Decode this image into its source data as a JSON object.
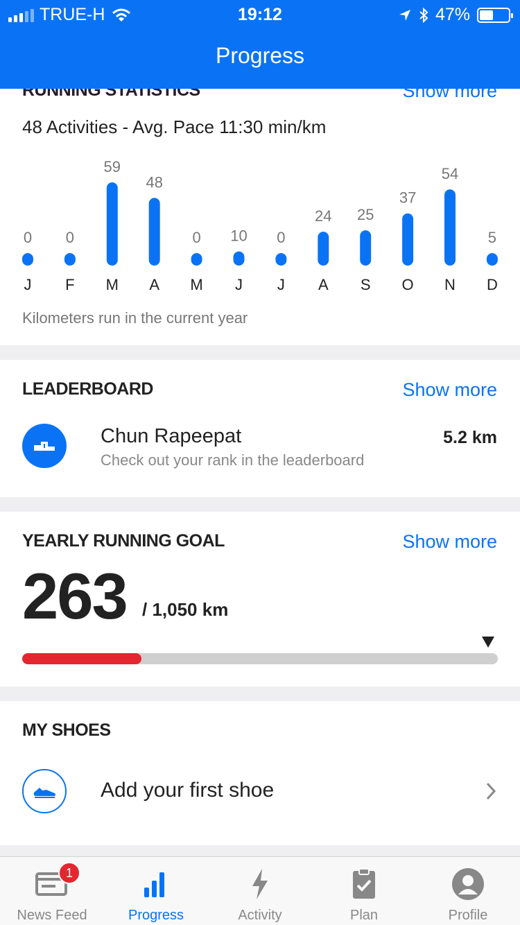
{
  "status_bar": {
    "carrier": "TRUE-H",
    "time": "19:12",
    "battery": "47%",
    "battery_level": 0.47
  },
  "header": {
    "title": "Progress"
  },
  "running_statistics": {
    "title": "RUNNING STATISTICS",
    "show_more": "Show more",
    "summary": "48 Activities - Avg. Pace 11:30 min/km",
    "caption": "Kilometers run in the current year"
  },
  "chart_data": {
    "type": "bar",
    "categories": [
      "J",
      "F",
      "M",
      "A",
      "M",
      "J",
      "J",
      "A",
      "S",
      "O",
      "N",
      "D"
    ],
    "values": [
      0,
      0,
      59,
      48,
      0,
      10,
      0,
      24,
      25,
      37,
      54,
      5
    ],
    "ylim": [
      0,
      59
    ],
    "grid": false,
    "color": "#0a73f5"
  },
  "leaderboard": {
    "title": "LEADERBOARD",
    "show_more": "Show more",
    "name": "Chun Rapeepat",
    "subtitle": "Check out your rank in the leaderboard",
    "distance": "5.2 km"
  },
  "yearly_goal": {
    "title": "YEARLY RUNNING GOAL",
    "show_more": "Show more",
    "current": "263",
    "total": "/ 1,050 km",
    "progress_fraction": 0.25,
    "expected_fraction": 0.98,
    "progress_color": "#e3262f"
  },
  "my_shoes": {
    "title": "MY SHOES",
    "add_label": "Add your first shoe"
  },
  "tab_bar": {
    "tabs": [
      {
        "label": "News Feed",
        "icon": "news-feed-icon",
        "badge": "1"
      },
      {
        "label": "Progress",
        "icon": "progress-chart-icon"
      },
      {
        "label": "Activity",
        "icon": "lightning-bolt-icon"
      },
      {
        "label": "Plan",
        "icon": "clipboard-check-icon"
      },
      {
        "label": "Profile",
        "icon": "profile-avatar-icon"
      }
    ],
    "active_index": 1
  },
  "colors": {
    "accent": "#0a73f5",
    "goal_fill": "#e3262f",
    "track": "#cfcfcf"
  }
}
